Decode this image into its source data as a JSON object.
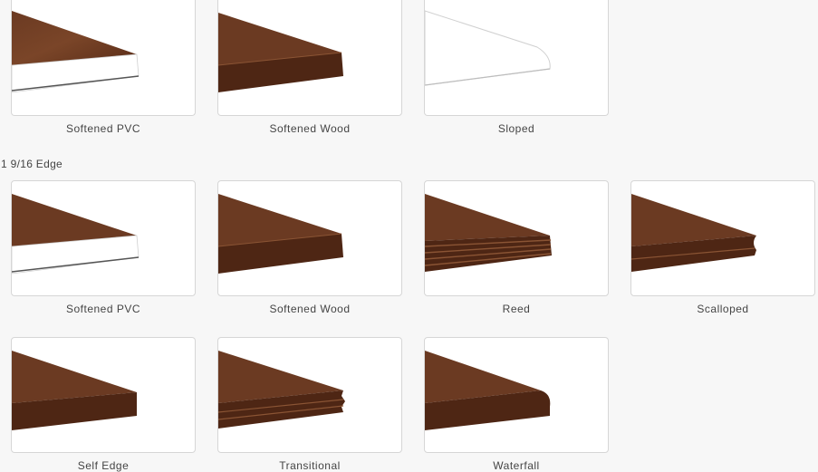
{
  "colors": {
    "wood_dark": "#4a2413",
    "wood_mid": "#6b3a22",
    "wood_light": "#8a5434",
    "pvc_white": "#ffffff",
    "card_border": "#d6d6d6",
    "background": "#f7f7f7"
  },
  "section_1_9_16": {
    "title": "1 9/16 Edge"
  },
  "options": [
    {
      "label": "Softened PVC",
      "profile": "softened-pvc"
    },
    {
      "label": "Softened Wood",
      "profile": "softened-wood"
    },
    {
      "label": "Sloped",
      "profile": "sloped-white"
    },
    {
      "label": "Softened PVC",
      "profile": "softened-pvc"
    },
    {
      "label": "Softened Wood",
      "profile": "softened-wood"
    },
    {
      "label": "Reed",
      "profile": "reed"
    },
    {
      "label": "Scalloped",
      "profile": "scalloped"
    },
    {
      "label": "Self Edge",
      "profile": "self-edge"
    },
    {
      "label": "Transitional",
      "profile": "transitional"
    },
    {
      "label": "Waterfall",
      "profile": "waterfall"
    }
  ]
}
